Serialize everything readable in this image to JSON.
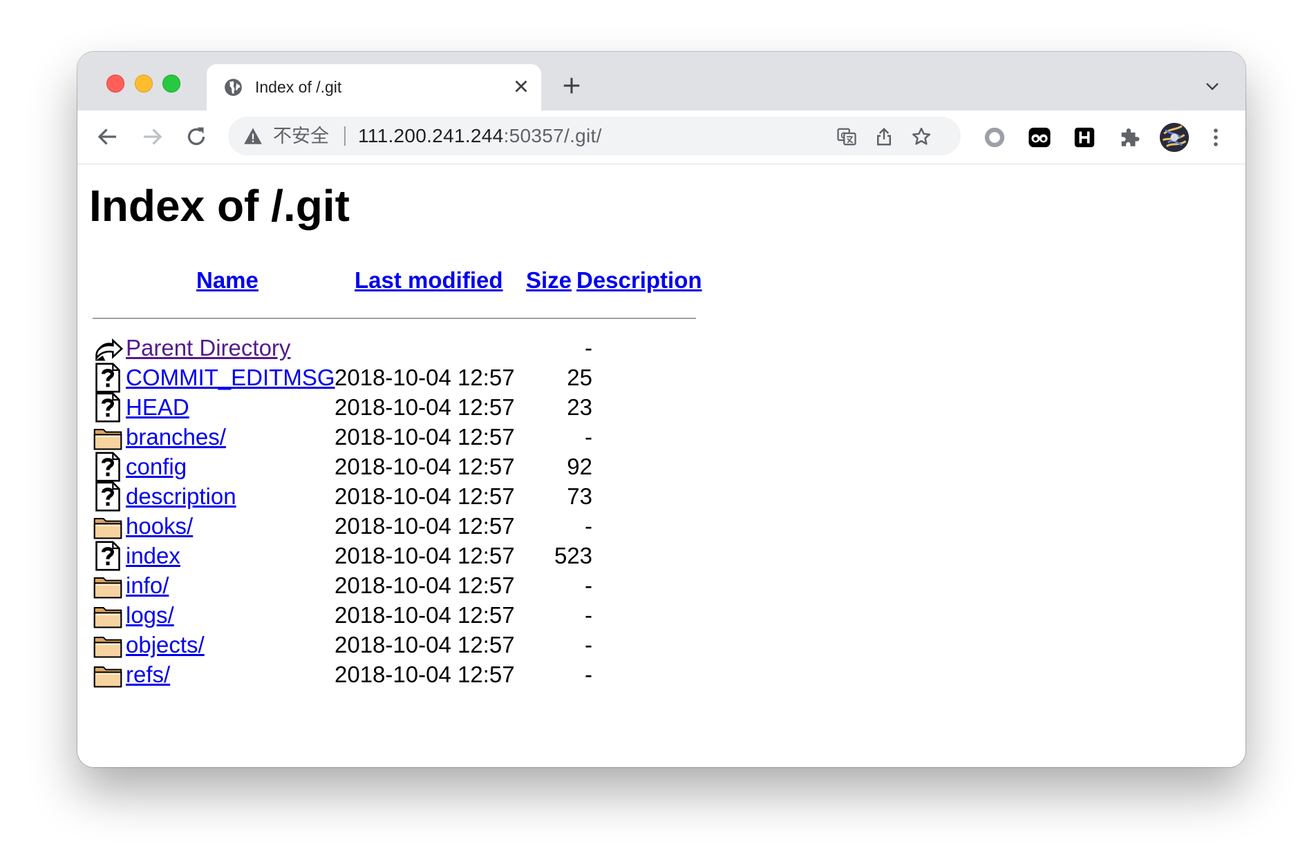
{
  "tab": {
    "title": "Index of /.git",
    "close_icon": "close-icon",
    "favicon": "globe-icon"
  },
  "toolbar": {
    "security_label": "不安全",
    "url_host": "111.200.241.244",
    "url_rest": ":50357/.git/"
  },
  "page": {
    "title": "Index of /.git",
    "headers": {
      "name": "Name",
      "last_modified": "Last modified",
      "size": "Size",
      "description": "Description"
    },
    "entries": [
      {
        "name": "Parent Directory",
        "date": "",
        "size": "-",
        "icon": "back-icon",
        "visited": true
      },
      {
        "name": "COMMIT_EDITMSG",
        "date": "2018-10-04 12:57",
        "size": "25",
        "icon": "unknown-file-icon"
      },
      {
        "name": "HEAD",
        "date": "2018-10-04 12:57",
        "size": "23",
        "icon": "unknown-file-icon"
      },
      {
        "name": "branches/",
        "date": "2018-10-04 12:57",
        "size": "-",
        "icon": "folder-icon"
      },
      {
        "name": "config",
        "date": "2018-10-04 12:57",
        "size": "92",
        "icon": "unknown-file-icon"
      },
      {
        "name": "description",
        "date": "2018-10-04 12:57",
        "size": "73",
        "icon": "unknown-file-icon"
      },
      {
        "name": "hooks/",
        "date": "2018-10-04 12:57",
        "size": "-",
        "icon": "folder-icon"
      },
      {
        "name": "index",
        "date": "2018-10-04 12:57",
        "size": "523",
        "icon": "unknown-file-icon"
      },
      {
        "name": "info/",
        "date": "2018-10-04 12:57",
        "size": "-",
        "icon": "folder-icon"
      },
      {
        "name": "logs/",
        "date": "2018-10-04 12:57",
        "size": "-",
        "icon": "folder-icon"
      },
      {
        "name": "objects/",
        "date": "2018-10-04 12:57",
        "size": "-",
        "icon": "folder-icon"
      },
      {
        "name": "refs/",
        "date": "2018-10-04 12:57",
        "size": "-",
        "icon": "folder-icon"
      }
    ]
  },
  "colors": {
    "link": "#0000ee",
    "visited_link": "#551a8b",
    "tabstrip": "#dfe1e5",
    "omnibox": "#f1f3f4"
  }
}
